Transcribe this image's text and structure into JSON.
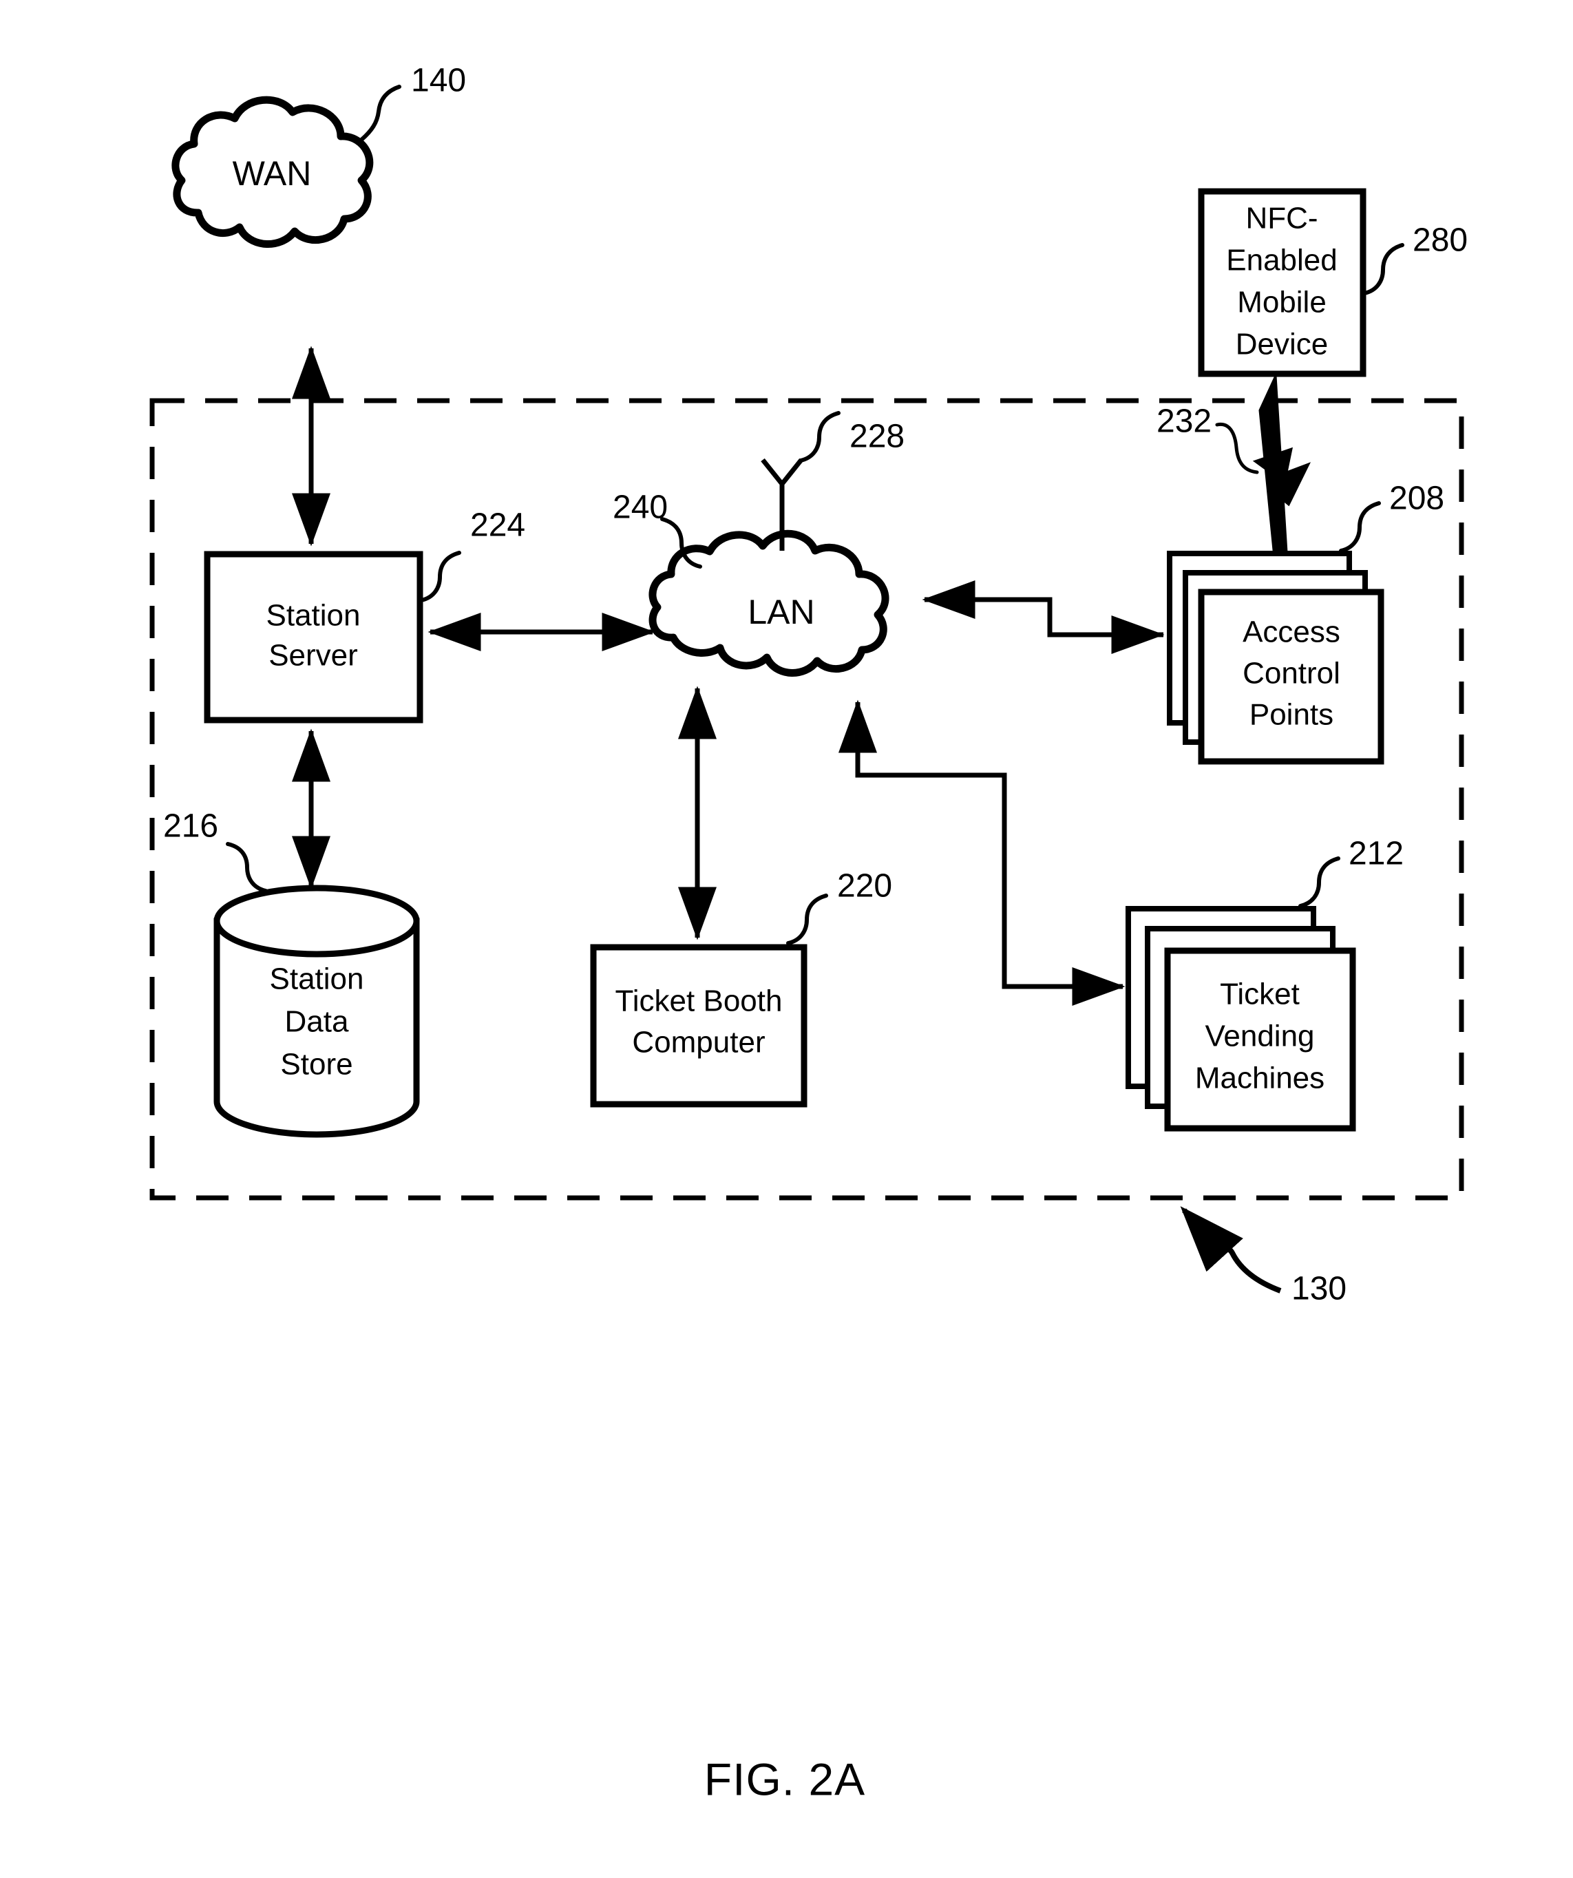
{
  "figure": {
    "caption": "FIG. 2A",
    "boundary_ref": "130"
  },
  "nodes": {
    "wan": {
      "label": "WAN",
      "ref": "140",
      "shape": "cloud"
    },
    "nfc_device": {
      "label_lines": [
        "NFC-",
        "Enabled",
        "Mobile",
        "Device"
      ],
      "ref": "280",
      "shape": "rectangle"
    },
    "station_server": {
      "label_lines": [
        "Station",
        "Server"
      ],
      "ref": "224",
      "shape": "rectangle"
    },
    "lan": {
      "label": "LAN",
      "ref": "240",
      "shape": "cloud",
      "antenna_ref": "228"
    },
    "access_control_points": {
      "label_lines": [
        "Access",
        "Control",
        "Points"
      ],
      "ref": "208",
      "shape": "stacked-rectangles"
    },
    "station_data_store": {
      "label_lines": [
        "Station",
        "Data",
        "Store"
      ],
      "ref": "216",
      "shape": "cylinder"
    },
    "ticket_booth_computer": {
      "label_lines": [
        "Ticket Booth",
        "Computer"
      ],
      "ref": "220",
      "shape": "rectangle"
    },
    "ticket_vending_machines": {
      "label_lines": [
        "Ticket",
        "Vending",
        "Machines"
      ],
      "ref": "212",
      "shape": "stacked-rectangles"
    },
    "nfc_link": {
      "ref": "232",
      "shape": "lightning-bolt"
    }
  },
  "colors": {
    "line": "#000000",
    "fill": "#ffffff"
  }
}
